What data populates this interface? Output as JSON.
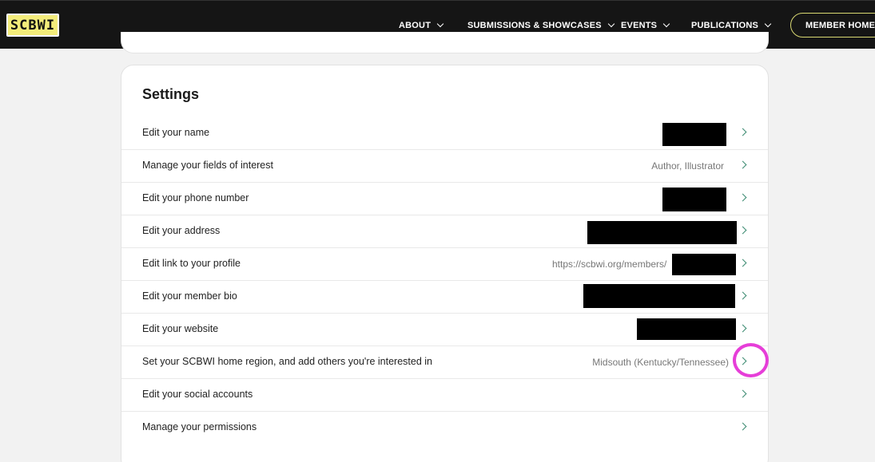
{
  "header": {
    "logo_text": "SCBWI",
    "nav": [
      {
        "label": "ABOUT"
      },
      {
        "label": "SUBMISSIONS & SHOWCASES"
      },
      {
        "label": "EVENTS"
      },
      {
        "label": "PUBLICATIONS"
      }
    ],
    "member_home_label": "MEMBER HOME"
  },
  "settings": {
    "title": "Settings",
    "rows": [
      {
        "label": "Edit your name",
        "value": ""
      },
      {
        "label": "Manage your fields of interest",
        "value": "Author, Illustrator"
      },
      {
        "label": "Edit your phone number",
        "value": ""
      },
      {
        "label": "Edit your address",
        "value": ""
      },
      {
        "label": "Edit link to your profile",
        "value": "https://scbwi.org/members/"
      },
      {
        "label": "Edit your member bio",
        "value": ""
      },
      {
        "label": "Edit your website",
        "value": ""
      },
      {
        "label": "Set your SCBWI home region, and add others you're interested in",
        "value": "Midsouth (Kentucky/Tennessee)"
      },
      {
        "label": "Edit your social accounts",
        "value": ""
      },
      {
        "label": "Manage your permissions",
        "value": ""
      }
    ]
  },
  "colors": {
    "header_bg": "#151515",
    "logo_bg": "#f3ec7a",
    "chevron_accent": "#3a8a70",
    "highlight_ring": "#e63ed8"
  }
}
